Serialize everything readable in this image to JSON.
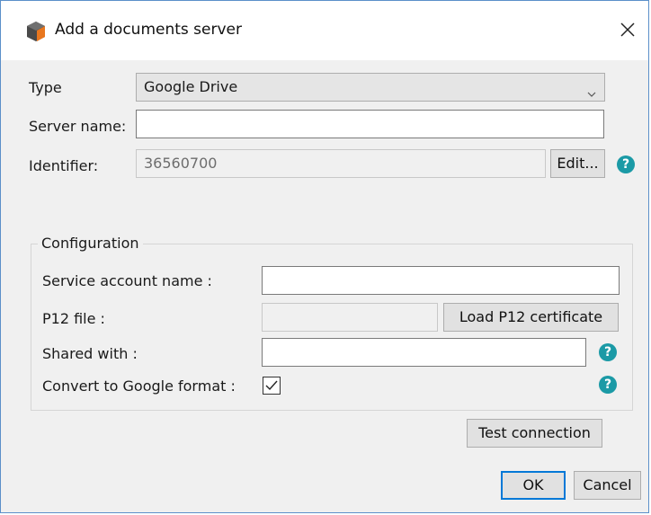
{
  "dialog": {
    "title": "Add a documents server",
    "app_icon": "app-logo-icon",
    "close_icon": "close-icon"
  },
  "form": {
    "type_label": "Type",
    "type_value": "Google Drive",
    "server_name_label": "Server name:",
    "server_name_value": "",
    "identifier_label": "Identifier:",
    "identifier_value": "36560700",
    "edit_button": "Edit..."
  },
  "configuration": {
    "group_label": "Configuration",
    "service_account_label": "Service account name :",
    "service_account_value": "",
    "p12_label": "P12 file :",
    "p12_value": "",
    "load_p12_button": "Load P12 certificate",
    "shared_with_label": "Shared with :",
    "shared_with_value": "",
    "convert_label": "Convert to Google format :",
    "convert_checked": true
  },
  "actions": {
    "test_connection": "Test connection",
    "ok": "OK",
    "cancel": "Cancel"
  },
  "help_icon_glyph": "?",
  "colors": {
    "accent": "#0078d7",
    "help": "#1b9aa6",
    "window_border": "#5b8fc9"
  }
}
